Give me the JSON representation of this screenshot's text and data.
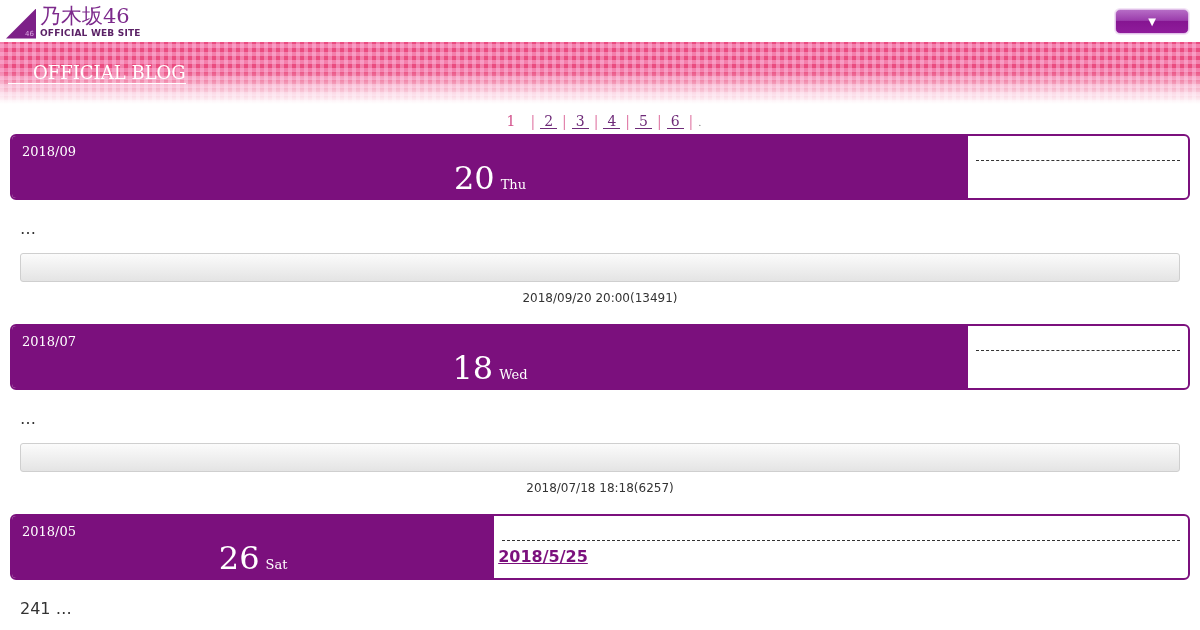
{
  "header": {
    "logo": {
      "mark_text": "46",
      "wordmark": "乃木坂46",
      "tagline": "OFFICIAL WEB SITE"
    },
    "menu_button": {
      "label": "▼"
    }
  },
  "banner": {
    "title": "OFFICIAL BLOG"
  },
  "pagination": {
    "pages": [
      {
        "label": "1",
        "selected": true,
        "separator": "|"
      },
      {
        "label": "2",
        "selected": false,
        "separator": "|"
      },
      {
        "label": "3",
        "selected": false,
        "separator": "|"
      },
      {
        "label": "4",
        "selected": false,
        "separator": "|"
      },
      {
        "label": "5",
        "selected": false,
        "separator": "|"
      },
      {
        "label": "6",
        "selected": false,
        "separator": "|"
      }
    ],
    "end": "."
  },
  "entries": [
    {
      "month": "2018/09",
      "day": "20",
      "weekday": "Thu",
      "excerpt": "…",
      "footer": {
        "meta": "2018/09/20 20:00(13491)"
      }
    },
    {
      "month": "2018/07",
      "day": "18",
      "weekday": "Wed",
      "excerpt": "…",
      "footer": {
        "meta": "2018/07/18 18:18(6257)"
      }
    },
    {
      "month": "2018/05",
      "day": "26",
      "weekday": "Sat",
      "title": "2018/5/25",
      "excerpt": "241 …"
    }
  ]
}
